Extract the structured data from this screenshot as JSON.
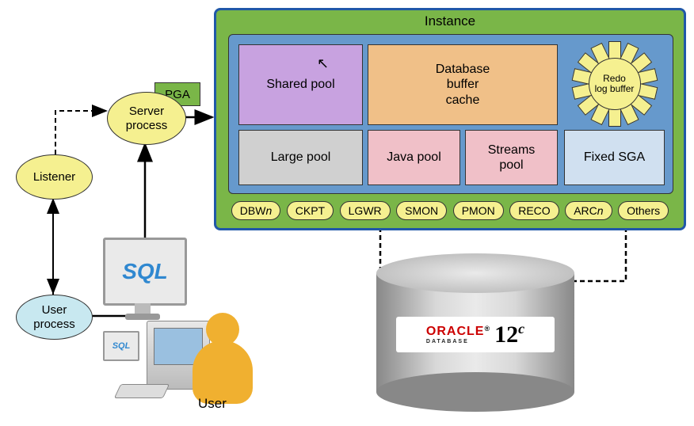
{
  "instance": {
    "title": "Instance",
    "sga": {
      "shared_pool": "Shared pool",
      "db_buffer_cache": "Database\nbuffer\ncache",
      "redo_log_buffer": "Redo\nlog buffer",
      "large_pool": "Large pool",
      "java_pool": "Java pool",
      "streams_pool": "Streams\npool",
      "fixed_sga": "Fixed SGA"
    },
    "bg_processes": [
      "DBWn",
      "CKPT",
      "LGWR",
      "SMON",
      "PMON",
      "RECO",
      "ARCn",
      "Others"
    ]
  },
  "nodes": {
    "pga": "PGA",
    "server_process": "Server\nprocess",
    "listener": "Listener",
    "user_process": "User\nprocess",
    "user_label": "User"
  },
  "workstation": {
    "sql_big": "SQL",
    "sql_small": "SQL"
  },
  "database": {
    "brand": "ORACLE",
    "brand_sub": "DATABASE",
    "version": "12",
    "version_suffix": "c"
  }
}
